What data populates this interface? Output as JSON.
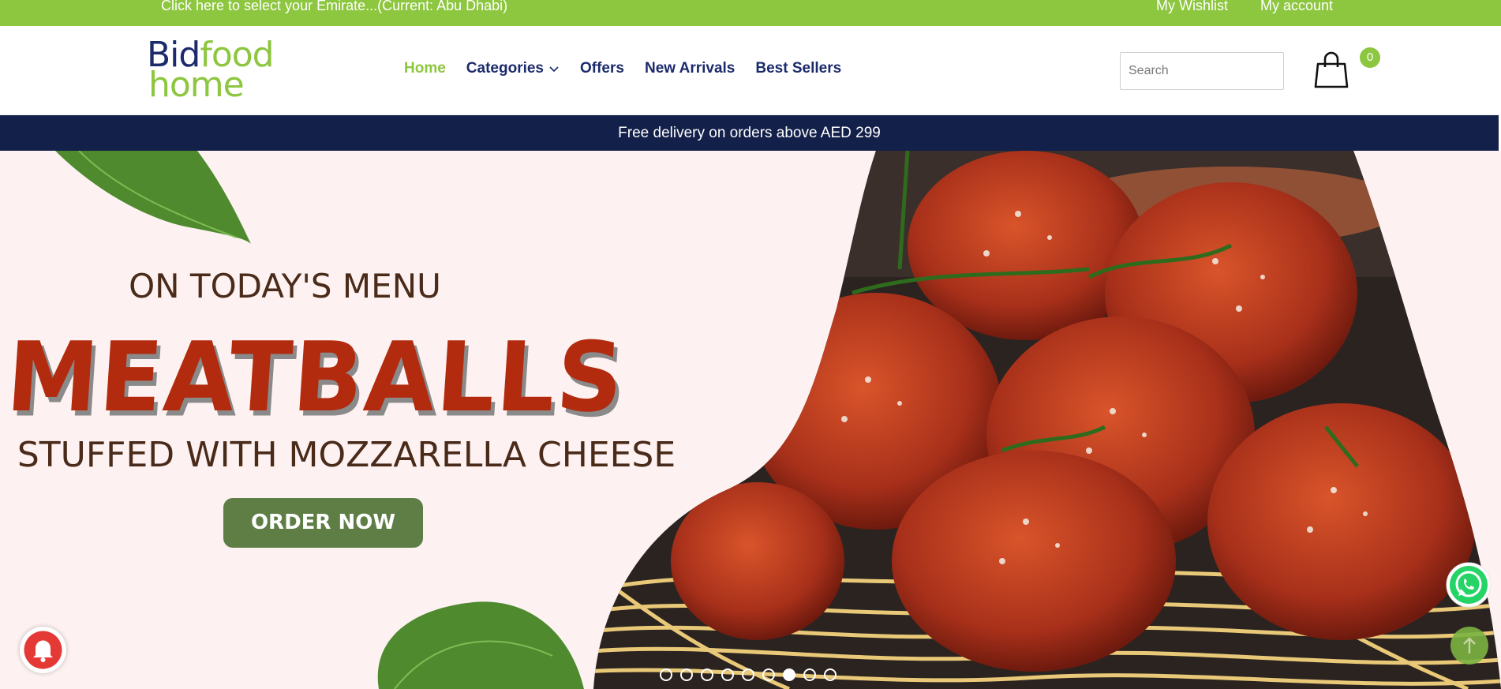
{
  "topbar": {
    "emirate_text": "Click here to select your Emirate...(Current: Abu Dhabi)",
    "wishlist": "My Wishlist",
    "account": "My account"
  },
  "header": {
    "logo": {
      "line1a": "Bid",
      "line1b": "food",
      "line2": "home"
    },
    "nav": [
      {
        "label": "Home"
      },
      {
        "label": "Categories"
      },
      {
        "label": "Offers"
      },
      {
        "label": "New Arrivals"
      },
      {
        "label": "Best Sellers"
      }
    ],
    "search_placeholder": "Search",
    "cart_count": "0"
  },
  "strip": {
    "text": "Free delivery on orders above AED 299"
  },
  "hero": {
    "subtitle": "ON TODAY'S MENU",
    "title": "MEATBALLS",
    "tagline": "STUFFED WITH MOZZARELLA CHEESE",
    "cta": "ORDER NOW",
    "slides_count": 9,
    "active_slide": 7
  },
  "colors": {
    "accent_green": "#8dc63f",
    "navy": "#13204a",
    "title_red": "#b32b0e",
    "button_green": "#5e7e46",
    "hero_bg": "#fdf2f1"
  }
}
